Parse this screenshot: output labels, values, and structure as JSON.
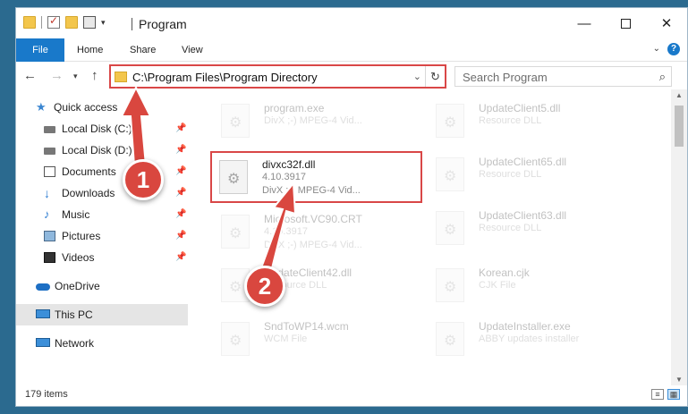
{
  "window": {
    "title": "Program",
    "controls": {
      "minimize": "—",
      "maximize": "",
      "close": "✕"
    }
  },
  "ribbon": {
    "tabs": [
      {
        "label": "File",
        "active": true
      },
      {
        "label": "Home"
      },
      {
        "label": "Share"
      },
      {
        "label": "View"
      }
    ],
    "help": "?"
  },
  "navigation": {
    "address": "C:\\Program Files\\Program Directory",
    "search_placeholder": "Search Program",
    "refresh_icon": "↻"
  },
  "sidebar": {
    "items": [
      {
        "label": "Quick access",
        "icon": "star-icon",
        "pinned": false
      },
      {
        "label": "Local Disk (C:)",
        "icon": "disk-icon",
        "pinned": true
      },
      {
        "label": "Local Disk (D:)",
        "icon": "disk-icon",
        "pinned": true
      },
      {
        "label": "Documents",
        "icon": "documents-icon",
        "pinned": true
      },
      {
        "label": "Downloads",
        "icon": "download-icon",
        "pinned": true
      },
      {
        "label": "Music",
        "icon": "music-icon",
        "pinned": true
      },
      {
        "label": "Pictures",
        "icon": "pictures-icon",
        "pinned": true
      },
      {
        "label": "Videos",
        "icon": "videos-icon",
        "pinned": true
      },
      {
        "label": "OneDrive",
        "icon": "cloud-icon",
        "pinned": false
      },
      {
        "label": "This PC",
        "icon": "computer-icon",
        "pinned": false,
        "selected": true
      },
      {
        "label": "Network",
        "icon": "network-icon",
        "pinned": false
      }
    ]
  },
  "files": [
    {
      "name": "program.exe",
      "line2": "DivX ;-) MPEG-4 Vid...",
      "line3": "",
      "faded": true
    },
    {
      "name": "UpdateClient5.dll",
      "line2": "Resource DLL",
      "line3": "",
      "faded": true
    },
    {
      "name": "divxc32f.dll",
      "line2": "4.10.3917",
      "line3": "DivX ;-) MPEG-4 Vid...",
      "faded": false,
      "highlighted": true
    },
    {
      "name": "UpdateClient65.dll",
      "line2": "Resource DLL",
      "line3": "",
      "faded": true
    },
    {
      "name": "Microsoft.VC90.CRT",
      "line2": "4.10.3917",
      "line3": "DivX ;-) MPEG-4 Vid...",
      "faded": true
    },
    {
      "name": "UpdateClient63.dll",
      "line2": "Resource DLL",
      "line3": "",
      "faded": true
    },
    {
      "name": "UpdateClient42.dll",
      "line2": "Resource DLL",
      "line3": "",
      "faded": true
    },
    {
      "name": "Korean.cjk",
      "line2": "CJK File",
      "line3": "",
      "faded": true
    },
    {
      "name": "SndToWP14.wcm",
      "line2": "WCM File",
      "line3": "",
      "faded": true
    },
    {
      "name": "UpdateInstaller.exe",
      "line2": "ABBY updates installer",
      "line3": "",
      "faded": true
    }
  ],
  "status": {
    "item_count": "179 items"
  },
  "annotations": [
    "1",
    "2"
  ]
}
